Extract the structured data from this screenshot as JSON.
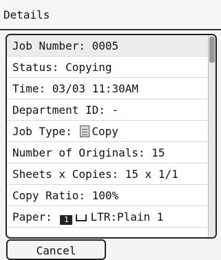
{
  "header": {
    "title": "Details"
  },
  "details": {
    "job_number": "Job Number: 0005",
    "status": "Status: Copying",
    "time": "Time: 03/03 11:30AM",
    "department_id": "Department ID: -",
    "job_type_prefix": "Job Type:",
    "job_type_value": "Copy",
    "number_of_originals": "Number of Originals: 15",
    "sheets_copies": "Sheets x Copies: 15 x 1/1",
    "copy_ratio": "Copy Ratio: 100%",
    "paper_prefix": "Paper:",
    "paper_drawer": "1",
    "paper_value": "LTR:Plain 1"
  },
  "footer": {
    "cancel_label": "Cancel"
  },
  "icons": {
    "job_type_icon": "copy-document-icon",
    "paper_drawer_icon": "paper-drawer-1-icon",
    "paper_tray_icon": "paper-tray-icon"
  }
}
